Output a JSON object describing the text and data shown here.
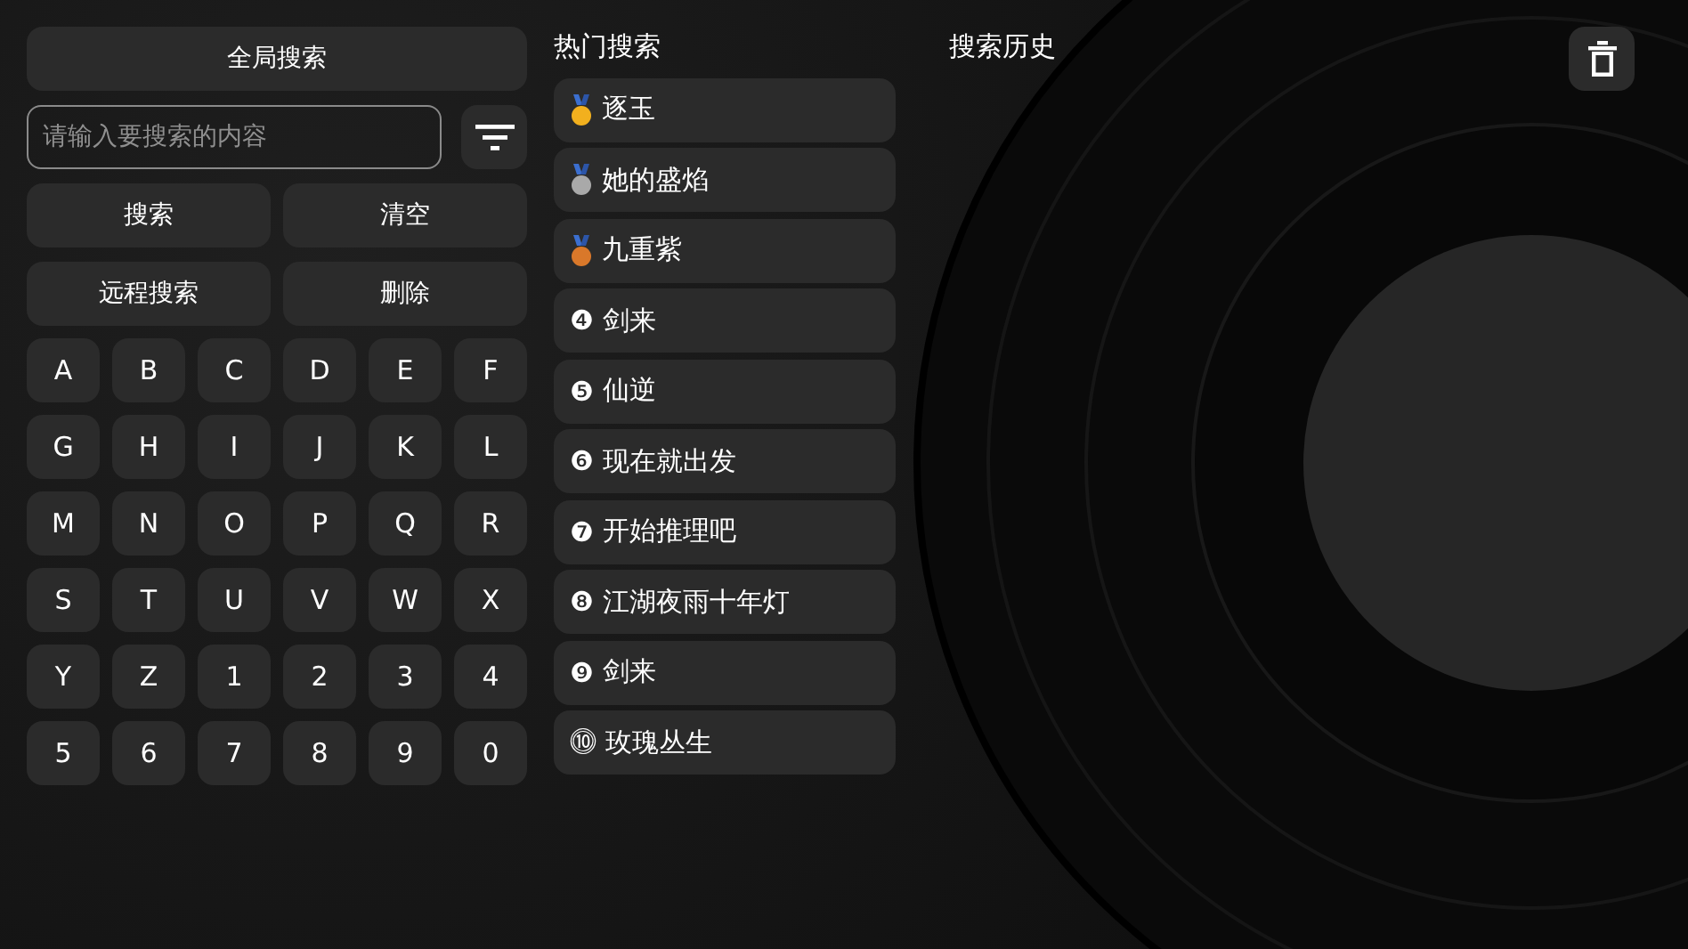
{
  "left_panel": {
    "global_search_button": "全局搜索",
    "search_field": {
      "placeholder": "请输入要搜索的内容"
    },
    "buttons": [
      "搜索",
      "清空",
      "远程搜索",
      "删除"
    ],
    "keys": [
      "A",
      "B",
      "C",
      "D",
      "E",
      "F",
      "G",
      "H",
      "I",
      "J",
      "K",
      "L",
      "M",
      "N",
      "O",
      "P",
      "Q",
      "R",
      "S",
      "T",
      "U",
      "V",
      "W",
      "X",
      "Y",
      "Z",
      "1",
      "2",
      "3",
      "4",
      "5",
      "6",
      "7",
      "8",
      "9",
      "0"
    ]
  },
  "hot_search": {
    "title": "热门搜索",
    "items": [
      {
        "kind": "medal",
        "color": "#f2b01e",
        "title": "逐玉"
      },
      {
        "kind": "medal",
        "color": "#a9a9a9",
        "title": "她的盛焰"
      },
      {
        "kind": "medal",
        "color": "#d9782a",
        "title": "九重紫"
      },
      {
        "kind": "number",
        "rank": "❹",
        "title": "剑来"
      },
      {
        "kind": "number",
        "rank": "❺",
        "title": "仙逆"
      },
      {
        "kind": "number",
        "rank": "❻",
        "title": "现在就出发"
      },
      {
        "kind": "number",
        "rank": "❼",
        "title": "开始推理吧"
      },
      {
        "kind": "number",
        "rank": "❽",
        "title": "江湖夜雨十年灯"
      },
      {
        "kind": "number",
        "rank": "❾",
        "title": "剑来"
      },
      {
        "kind": "number",
        "rank": "⓾",
        "title": "玫瑰丛生"
      }
    ]
  },
  "history": {
    "title": "搜索历史"
  }
}
